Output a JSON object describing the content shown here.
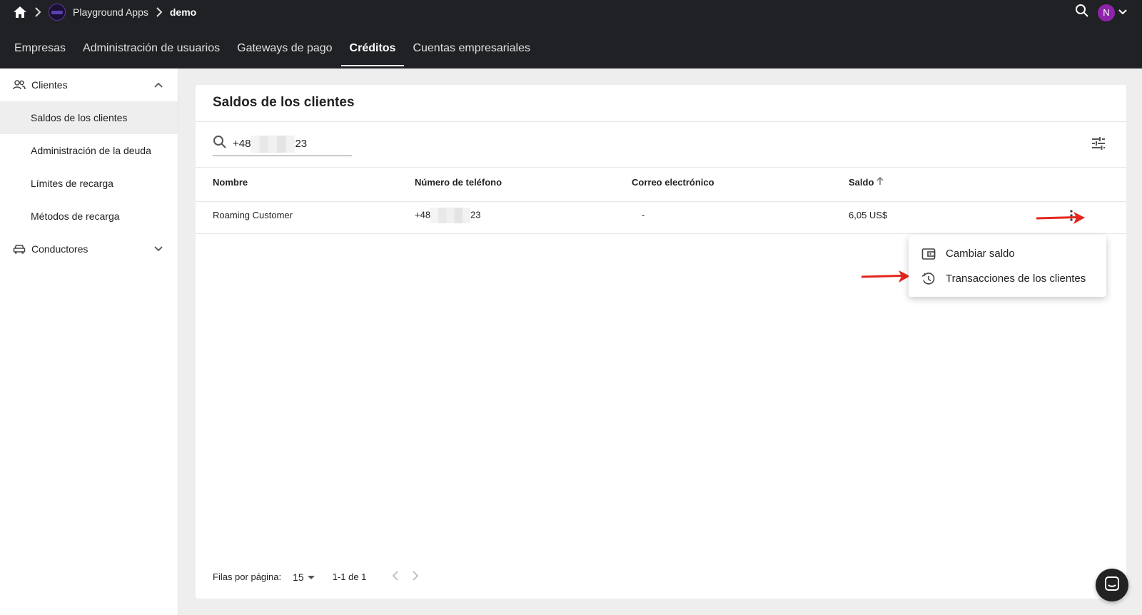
{
  "breadcrumb": {
    "org": "Playground Apps",
    "current": "demo"
  },
  "user": {
    "initial": "N"
  },
  "nav": {
    "tabs": [
      {
        "label": "Empresas"
      },
      {
        "label": "Administración de usuarios"
      },
      {
        "label": "Gateways de pago"
      },
      {
        "label": "Créditos"
      },
      {
        "label": "Cuentas empresariales"
      }
    ],
    "active": "Créditos"
  },
  "sidebar": {
    "clientes_label": "Clientes",
    "items": [
      {
        "label": "Saldos de los clientes"
      },
      {
        "label": "Administración de la deuda"
      },
      {
        "label": "Límites de recarga"
      },
      {
        "label": "Métodos de recarga"
      }
    ],
    "conductores_label": "Conductores"
  },
  "page": {
    "title": "Saldos de los clientes"
  },
  "search": {
    "value_prefix": "+48",
    "value_suffix": "23"
  },
  "table": {
    "headers": {
      "name": "Nombre",
      "phone": "Número de teléfono",
      "email": "Correo electrónico",
      "balance": "Saldo"
    },
    "rows": [
      {
        "name": "Roaming Customer",
        "phone_prefix": "+48",
        "phone_suffix": "23",
        "email": "-",
        "balance": "6,05 US$"
      }
    ]
  },
  "row_menu": {
    "items": [
      {
        "label": "Cambiar saldo",
        "icon": "wallet-icon"
      },
      {
        "label": "Transacciones de los clientes",
        "icon": "history-icon"
      }
    ]
  },
  "pagination": {
    "rows_label": "Filas por página:",
    "rows_value": "15",
    "range": "1-1 de 1"
  },
  "colors": {
    "topbar": "#202124",
    "avatar": "#8e24aa",
    "annotation_arrow": "#e3261c"
  }
}
